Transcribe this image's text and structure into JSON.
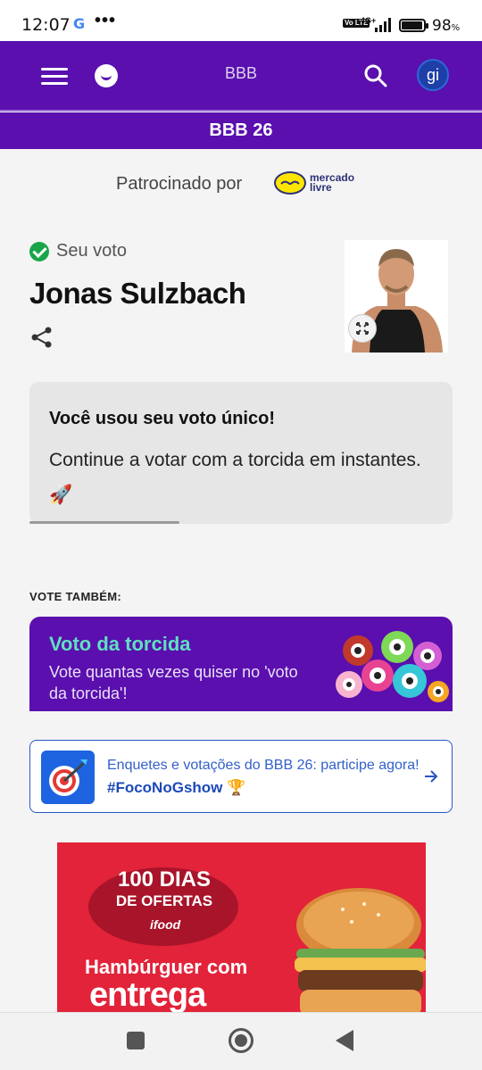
{
  "status_bar": {
    "time": "12:07",
    "google_letter": "G",
    "more": "•••",
    "volte": "Vo LTE",
    "network": "4G+",
    "battery_pct": "98",
    "battery_unit": "%"
  },
  "header": {
    "title": "BBB",
    "avatar_initials": "gi",
    "section_title": "BBB 26"
  },
  "sponsor": {
    "label": "Patrocinado por",
    "brand_line1": "mercado",
    "brand_line2": "livre"
  },
  "vote": {
    "status": "Seu voto",
    "candidate": "Jonas Sulzbach"
  },
  "info": {
    "title": "Você usou seu voto único!",
    "message": "Continue a votar com a torcida em instantes. 🚀"
  },
  "vote_also": {
    "label": "VOTE TAMBÉM:",
    "promo_title": "Voto da torcida",
    "promo_subtitle": "Vote quantas vezes quiser no 'voto da torcida'!"
  },
  "foco": {
    "line1": "Enquetes e votações do BBB 26: participe agora!",
    "line2": "#FocoNoGshow 🏆"
  },
  "ad": {
    "badge_line1": "100 DIAS",
    "badge_line2": "DE OFERTAS",
    "brand": "ifood",
    "headline1": "Hambúrguer com",
    "headline2": "entrega"
  },
  "colors": {
    "brand_purple": "#5a0fae",
    "accent_teal": "#5fe0c0",
    "link_blue": "#2b55c6",
    "ad_red": "#e2233a",
    "success_green": "#19a64a"
  }
}
